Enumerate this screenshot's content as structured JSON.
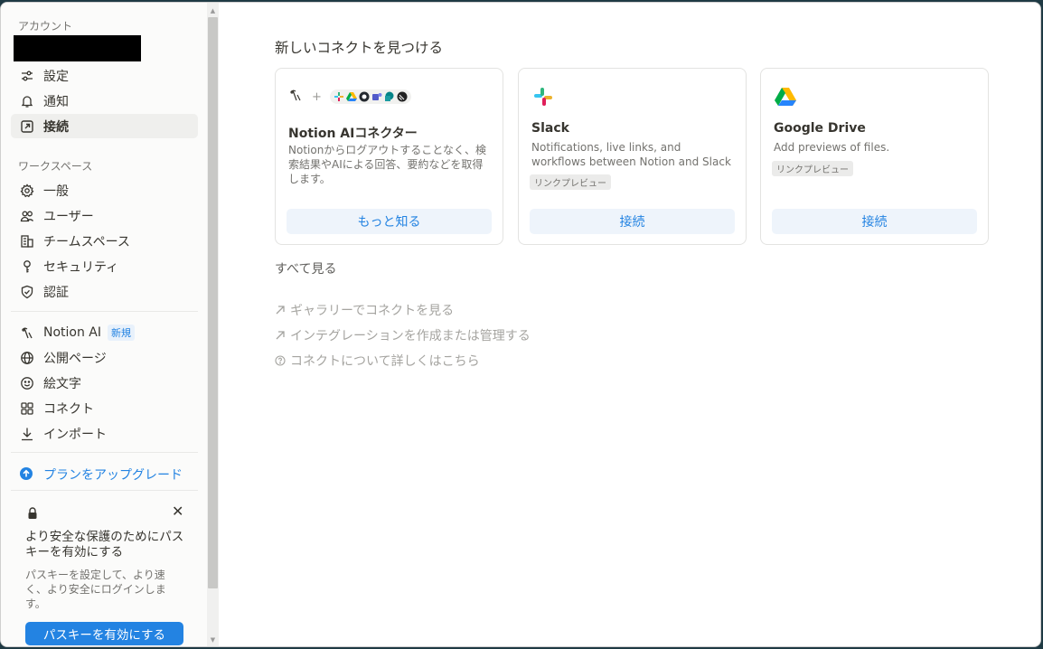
{
  "sidebar": {
    "account_title": "アカウント",
    "account_items": [
      {
        "label": "設定",
        "icon": "sliders-icon"
      },
      {
        "label": "通知",
        "icon": "bell-icon"
      },
      {
        "label": "接続",
        "icon": "arrow-up-right-box-icon",
        "active": true
      }
    ],
    "workspace_title": "ワークスペース",
    "workspace_items": [
      {
        "label": "一般",
        "icon": "gear-icon"
      },
      {
        "label": "ユーザー",
        "icon": "users-icon"
      },
      {
        "label": "チームスペース",
        "icon": "building-icon"
      },
      {
        "label": "セキュリティ",
        "icon": "key-icon"
      },
      {
        "label": "認証",
        "icon": "shield-check-icon"
      }
    ],
    "extra_items": [
      {
        "label": "Notion AI",
        "icon": "notion-ai-icon",
        "badge": "新規"
      },
      {
        "label": "公開ページ",
        "icon": "globe-icon"
      },
      {
        "label": "絵文字",
        "icon": "smiley-icon"
      },
      {
        "label": "コネクト",
        "icon": "grid-icon"
      },
      {
        "label": "インポート",
        "icon": "download-icon"
      }
    ],
    "upgrade_label": "プランをアップグレード",
    "passkey": {
      "title": "より安全な保護のためにパスキーを有効にする",
      "description": "パスキーを設定して、より速く、より安全にログインします。",
      "button": "パスキーを有効にする"
    }
  },
  "main": {
    "heading": "新しいコネクトを見つける",
    "cards": [
      {
        "name": "Notion AIコネクター",
        "description": "Notionからログアウトすることなく、検索結果やAIによる回答、要約などを取得します。",
        "tag": "",
        "button": "もっと知る",
        "plus": "+"
      },
      {
        "name": "Slack",
        "description": "Notifications, live links, and workflows between Notion and Slack",
        "tag": "リンクプレビュー",
        "button": "接続"
      },
      {
        "name": "Google Drive",
        "description": "Add previews of files.",
        "tag": "リンクプレビュー",
        "button": "接続"
      }
    ],
    "see_all": "すべて見る",
    "links": [
      {
        "label": "ギャラリーでコネクトを見る",
        "icon": "arrow-up-right-icon"
      },
      {
        "label": "インテグレーションを作成または管理する",
        "icon": "arrow-up-right-icon"
      },
      {
        "label": "コネクトについて詳しくはこちら",
        "icon": "question-circle-icon"
      }
    ]
  },
  "colors": {
    "accent": "#2383e2",
    "text": "#37352f",
    "muted": "#73726e",
    "sidebar_bg": "#fbfbfa"
  }
}
